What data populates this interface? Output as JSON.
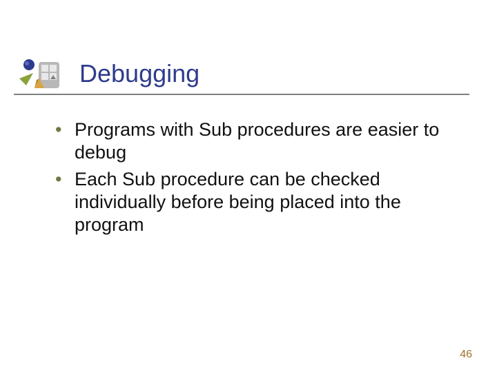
{
  "slide": {
    "title": "Debugging",
    "bullets": [
      "Programs with Sub procedures are easier to debug",
      "Each Sub procedure can be checked individually before being placed into the program"
    ],
    "page_number": "46"
  }
}
